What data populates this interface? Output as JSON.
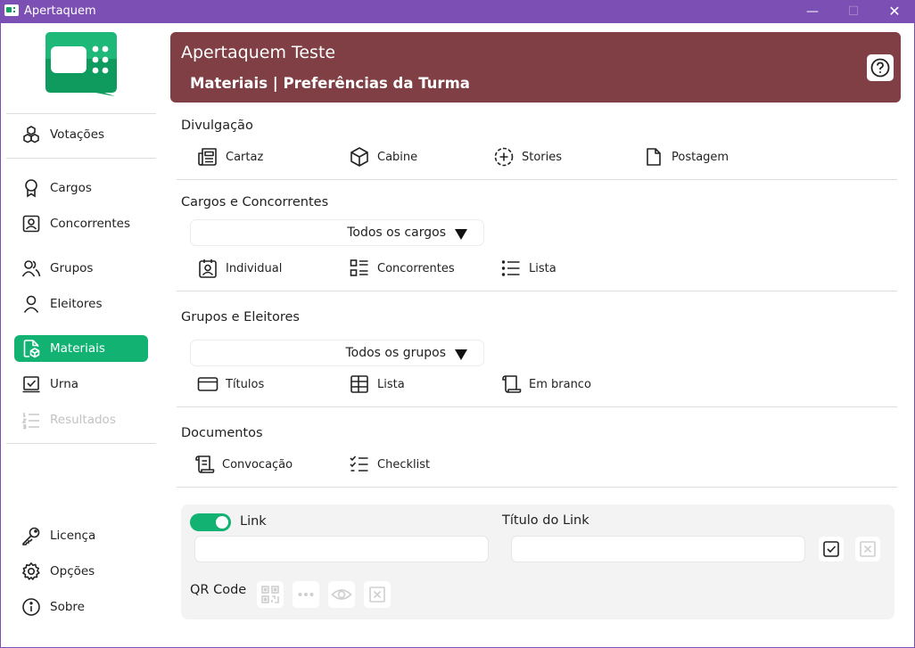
{
  "window": {
    "title": "Apertaquem",
    "minimize_glyph": "—",
    "maximize_glyph": "☐",
    "close_glyph": "✕"
  },
  "sidebar": {
    "items": [
      {
        "label": "Votações",
        "icon": "cubes-icon"
      },
      {
        "label": "Cargos",
        "icon": "ribbon-icon"
      },
      {
        "label": "Concorrentes",
        "icon": "contact-icon"
      },
      {
        "label": "Grupos",
        "icon": "people-icon"
      },
      {
        "label": "Eleitores",
        "icon": "person-icon"
      },
      {
        "label": "Materiais",
        "icon": "document-cube-icon",
        "active": true
      },
      {
        "label": "Urna",
        "icon": "ballot-box-icon"
      },
      {
        "label": "Resultados",
        "icon": "numbered-list-icon",
        "disabled": true
      },
      {
        "label": "Licença",
        "icon": "key-icon"
      },
      {
        "label": "Opções",
        "icon": "gear-icon"
      },
      {
        "label": "Sobre",
        "icon": "info-icon"
      }
    ]
  },
  "header": {
    "title": "Apertaquem Teste",
    "subtitle": "Materiais | Preferências da Turma"
  },
  "sections": {
    "divulgacao": {
      "title": "Divulgação",
      "items": [
        "Cartaz",
        "Cabine",
        "Stories",
        "Postagem"
      ]
    },
    "cargos": {
      "title": "Cargos e Concorrentes",
      "dropdown": "Todos os cargos",
      "items": [
        "Individual",
        "Concorrentes",
        "Lista"
      ]
    },
    "grupos": {
      "title": "Grupos e Eleitores",
      "dropdown": "Todos os grupos",
      "items": [
        "Títulos",
        "Lista",
        "Em branco"
      ]
    },
    "documentos": {
      "title": "Documentos",
      "items": [
        "Convocação",
        "Checklist"
      ]
    }
  },
  "link_panel": {
    "toggle_on": true,
    "link_label": "Link",
    "link_value": "",
    "link_title_label": "Título do Link",
    "link_title_value": "",
    "qr_label": "QR Code"
  },
  "colors": {
    "accent": "#12b273",
    "header_bg": "#7f3f44",
    "titlebar": "#7b4fb3"
  }
}
